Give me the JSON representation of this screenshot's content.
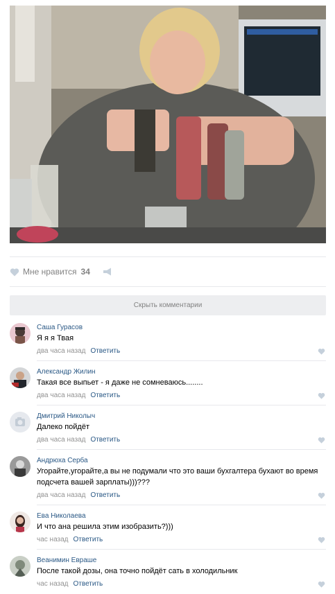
{
  "post": {
    "likes_label": "Мне нравится",
    "likes_count": "34"
  },
  "hide_comments_label": "Скрыть комментарии",
  "reply_label": "Ответить",
  "comments": [
    {
      "author": "Саша Гурасов",
      "text": "Я я я Твая",
      "time": "два часа назад"
    },
    {
      "author": "Александр Жилин",
      "text": "Такая все выпьет - я даже не сомневаюсь........",
      "time": "два часа назад"
    },
    {
      "author": "Дмитрий Николыч",
      "text": "Далеко пойдёт",
      "time": "два часа назад"
    },
    {
      "author": "Андрюха Серба",
      "text": "Угорайте,угорайте,а вы не подумали что это ваши бухгалтера бухают во время подсчета вашей зарплаты)))???",
      "time": "два часа назад"
    },
    {
      "author": "Ева Николаева",
      "text": "И что ана решила этим изобразить?)))",
      "time": "час назад"
    },
    {
      "author": "Веанимин Евраше",
      "text": "После такой дозы, она точно пойдёт сать в холодильник",
      "time": "час назад"
    }
  ],
  "colors": {
    "link": "#2a5885",
    "muted": "#828282",
    "button_bg": "#edeef0"
  }
}
